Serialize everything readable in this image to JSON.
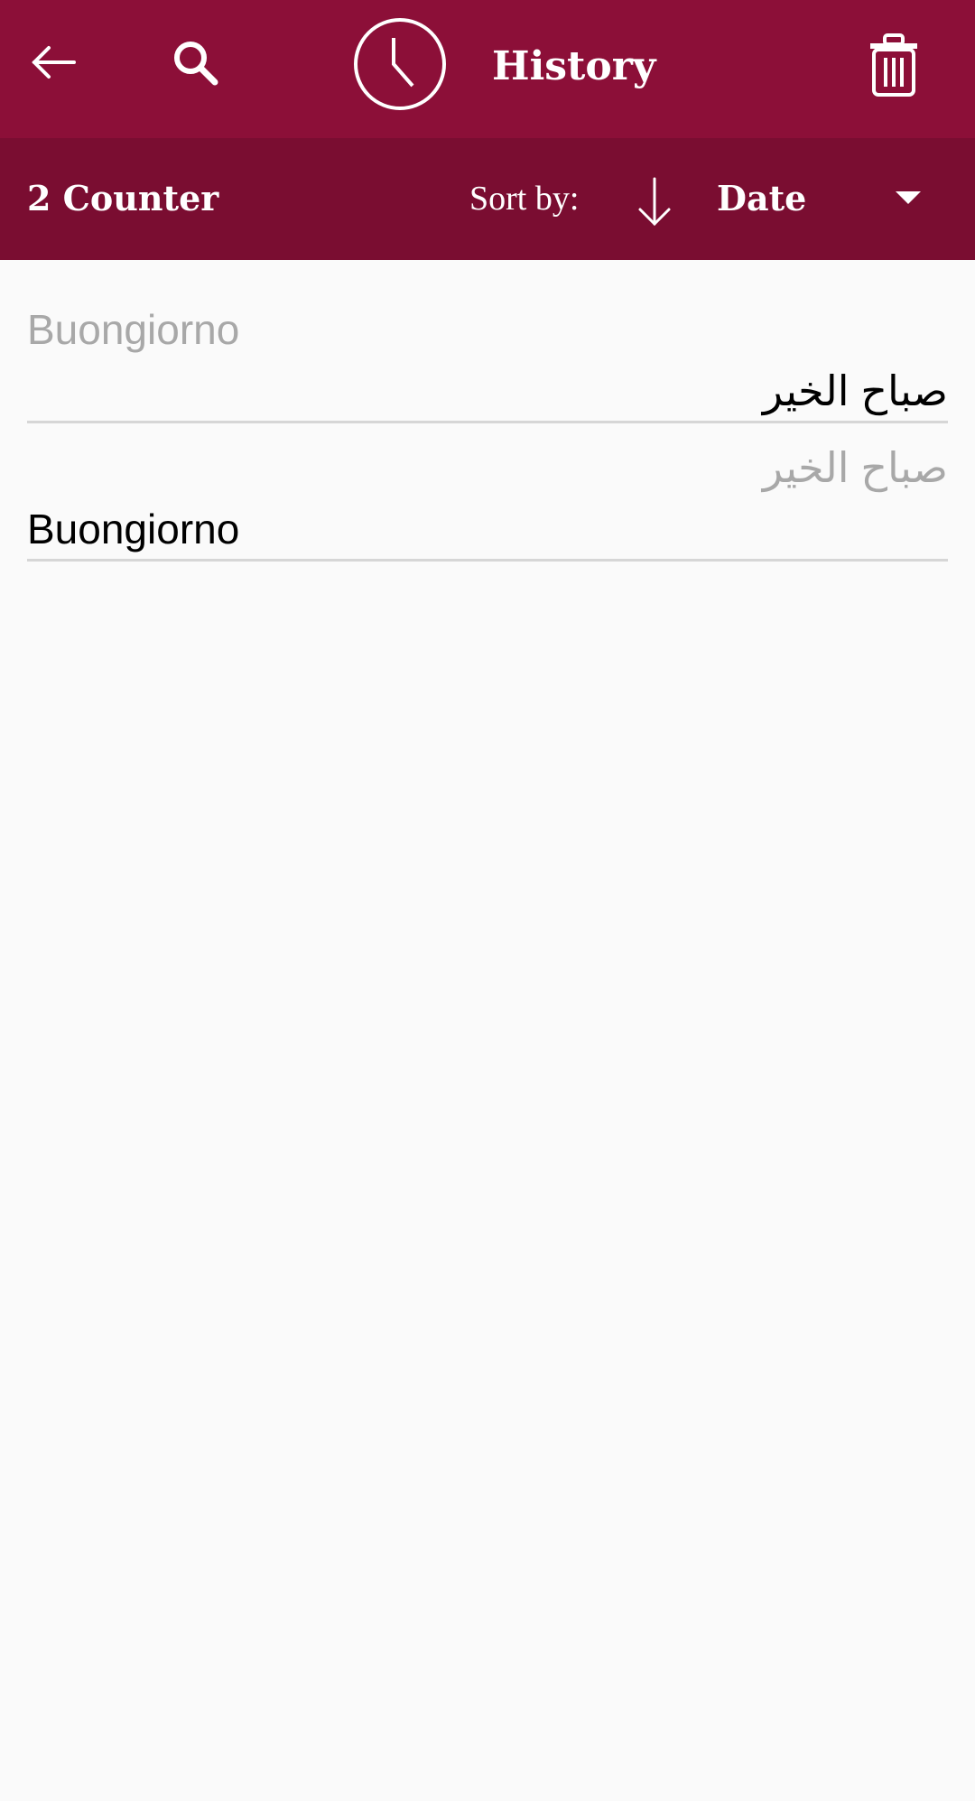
{
  "app_bar": {
    "back_icon": "arrow-left-icon",
    "search_icon": "search-icon",
    "clock_icon": "clock-icon",
    "title": "History",
    "delete_icon": "trash-icon"
  },
  "toolbar": {
    "counter_label": "2 Counter",
    "sort_label": "Sort by:",
    "sort_direction_icon": "arrow-down-icon",
    "sort_value": "Date",
    "dropdown_icon": "caret-down-icon"
  },
  "history": {
    "items": [
      {
        "source": "Buongiorno",
        "translation": "صباح الخير",
        "source_dir": "ltr",
        "translation_dir": "rtl"
      },
      {
        "source": "صباح الخير",
        "translation": "Buongiorno",
        "source_dir": "rtl",
        "translation_dir": "ltr"
      }
    ]
  },
  "colors": {
    "app_bar": "#8c0f38",
    "toolbar": "#7a0d31",
    "background": "#fafafa",
    "source_text": "#a8a8a8",
    "translation_text": "#000000",
    "divider": "#d6d6d6"
  }
}
